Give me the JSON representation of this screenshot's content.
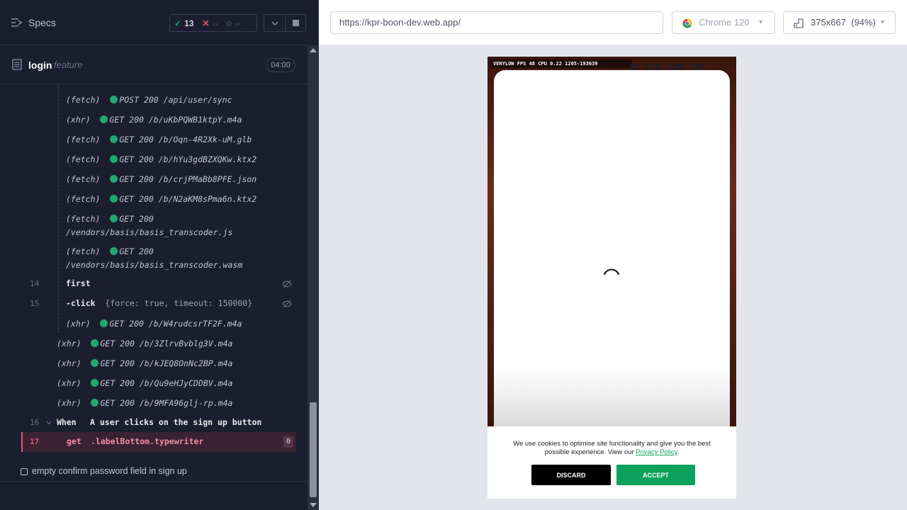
{
  "sidebar": {
    "title": "Specs",
    "stats": {
      "passed": "13",
      "failed": "--",
      "pending": "--"
    },
    "file": {
      "name": "login",
      "ext": "feature",
      "time": "04:00"
    },
    "log": [
      {
        "type": "(fetch)",
        "text": "POST 200 /api/user/sync"
      },
      {
        "type": "(xhr)",
        "text": "GET 200 /b/uKbPQWB1ktpY.m4a"
      },
      {
        "type": "(fetch)",
        "text": "GET 200 /b/Oqn-4R2Xk-uM.glb"
      },
      {
        "type": "(fetch)",
        "text": "GET 200 /b/hYu3gdBZXQKw.ktx2"
      },
      {
        "type": "(fetch)",
        "text": "GET 200 /b/crjPMaBb8PFE.json"
      },
      {
        "type": "(fetch)",
        "text": "GET 200 /b/N2aKM8sPma6n.ktx2"
      },
      {
        "type": "(fetch)",
        "text": "GET 200",
        "text2": "/vendors/basis/basis_transcoder.js"
      },
      {
        "type": "(fetch)",
        "text": "GET 200",
        "text2": "/vendors/basis/basis_transcoder.wasm"
      }
    ],
    "cmd14": {
      "num": "14",
      "cmd": "first"
    },
    "cmd15": {
      "num": "15",
      "cmd": "-click",
      "args": "{force: true, timeout: 150000}"
    },
    "log2": [
      {
        "type": "(xhr)",
        "text": "GET 200 /b/W4rudcsrTF2F.m4a"
      },
      {
        "type": "(xhr)",
        "text": "GET 200 /b/3ZlrvBvblg3V.m4a"
      },
      {
        "type": "(xhr)",
        "text": "GET 200 /b/kJEQ8OnNc2BP.m4a"
      },
      {
        "type": "(xhr)",
        "text": "GET 200 /b/Qu9eHJyCDDBV.m4a"
      },
      {
        "type": "(xhr)",
        "text": "GET 200 /b/9MFA96glj-rp.m4a"
      }
    ],
    "when": {
      "num": "16",
      "keyword": "When",
      "text": "A user clicks on the sign up button"
    },
    "error": {
      "num": "17",
      "cmd": "get",
      "selector": ".labelBottom.typewriter",
      "badge": "0"
    },
    "next_test": "empty confirm password field in sign up"
  },
  "browser": {
    "url": "https://kpr-boon-dev.web.app/",
    "name": "Chrome 120",
    "viewport": "375x667",
    "zoom": "(94%)"
  },
  "app": {
    "hud": "VERYLOW   FPS 48   CPU 0.22   1205-193639",
    "countdown": "3D 01H 58M 38S",
    "cookie_text": "We use cookies to optimise site functionality and give you the best possible experience. View our",
    "cookie_link": "Privacy Policy",
    "discard": "DISCARD",
    "accept": "ACCEPT"
  }
}
